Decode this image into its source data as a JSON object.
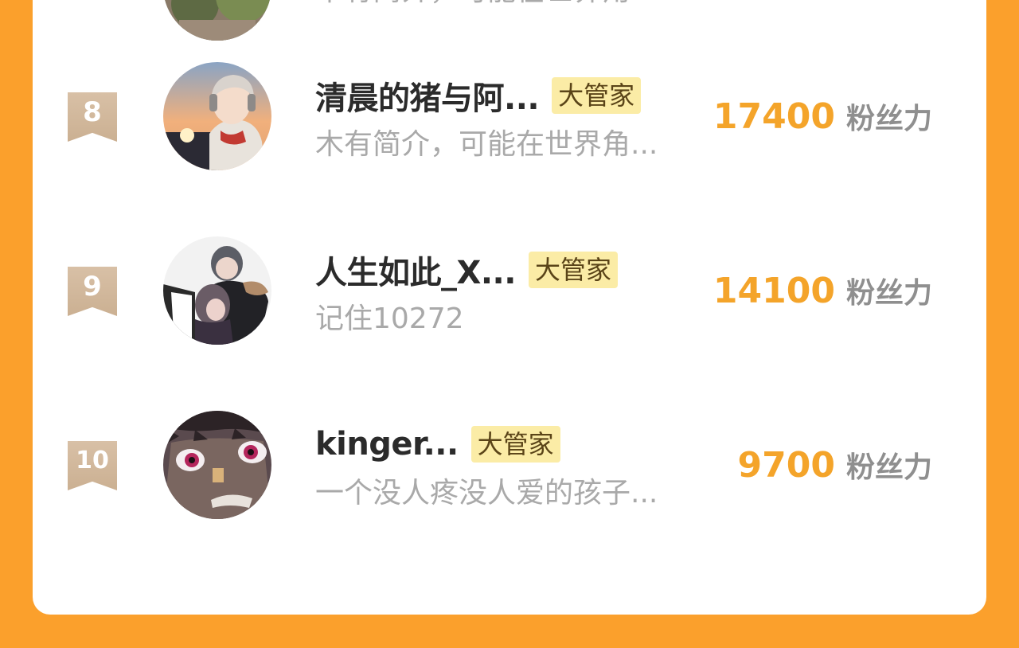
{
  "ranking": {
    "partial_row": {
      "bio": "木有简介，可能在世界角..."
    },
    "rows": [
      {
        "rank": "8",
        "name": "清晨的猪与阿...",
        "tag": "大管家",
        "bio": "木有简介，可能在世界角...",
        "fans_value": "17400",
        "fans_label": "粉丝力",
        "avatar": "avatar-anime-boy-headphones-sunset"
      },
      {
        "rank": "9",
        "name": "人生如此_X...",
        "tag": "大管家",
        "bio": "记住10272",
        "fans_value": "14100",
        "fans_label": "粉丝力",
        "avatar": "avatar-anime-couple-embrace"
      },
      {
        "rank": "10",
        "name": "kinger...",
        "tag": "大管家",
        "bio": "一个没人疼没人爱的孩子...",
        "fans_value": "9700",
        "fans_label": "粉丝力",
        "avatar": "avatar-anime-face-closeup"
      }
    ]
  },
  "colors": {
    "frame": "#fba02c",
    "card": "#ffffff",
    "fans_value": "#f4a42a",
    "tag_bg": "#fbeca6",
    "rank_badge": "#d2b79c"
  }
}
